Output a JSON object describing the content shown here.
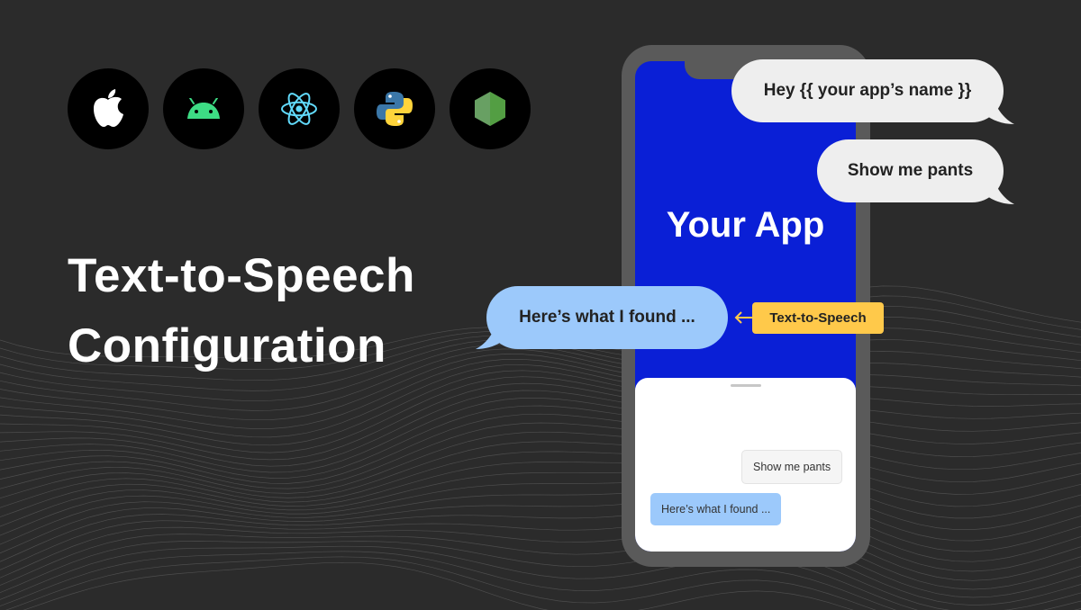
{
  "platforms": [
    {
      "name": "apple",
      "icon": "apple-icon"
    },
    {
      "name": "android",
      "icon": "android-icon"
    },
    {
      "name": "react",
      "icon": "react-icon"
    },
    {
      "name": "python",
      "icon": "python-icon"
    },
    {
      "name": "node",
      "icon": "node-icon"
    }
  ],
  "hero": {
    "title_line1": "Text-to-Speech",
    "title_line2": "Configuration"
  },
  "phone": {
    "app_label": "Your App",
    "chat": {
      "user_message": "Show me pants",
      "bot_message": "Here’s what I found ..."
    }
  },
  "bubbles": {
    "greeting": "Hey {{ your app’s name }}",
    "request": "Show me pants",
    "response": "Here’s what I found ..."
  },
  "tts_tag": "Text-to-Speech",
  "colors": {
    "background": "#2b2b2b",
    "app_blue": "#0a1fd6",
    "bubble_blue": "#9cc9fb",
    "tag_yellow": "#ffc94a",
    "android_green": "#3ddc84",
    "react_cyan": "#61dafb",
    "node_green": "#68a063"
  }
}
